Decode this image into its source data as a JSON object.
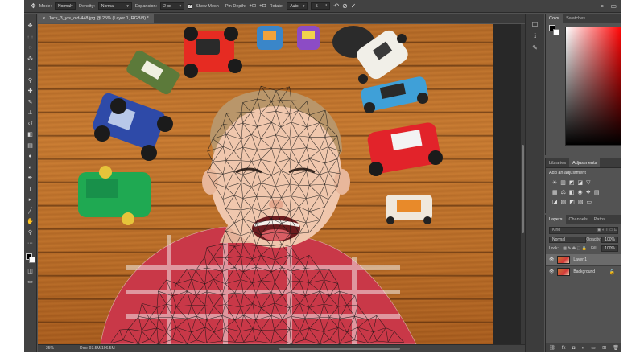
{
  "options_bar": {
    "mode_label": "Mode:",
    "mode_value": "Normal",
    "density_label": "Density:",
    "density_value": "Normal",
    "expansion_label": "Expansion:",
    "expansion_value": "2 px",
    "show_mesh_label": "Show Mesh",
    "show_mesh_checked": true,
    "pin_depth_label": "Pin Depth:",
    "rotate_label": "Rotate:",
    "rotate_value": "Auto",
    "rotate_degrees": "-5"
  },
  "document": {
    "tab_title": "Jack_3_yrs_old-448.jpg @ 25% (Layer 1, RGB/8) *",
    "zoom": "25%",
    "doc_info": "Doc: 93.5M/196.5M"
  },
  "color_panel": {
    "tabs": [
      "Color",
      "Swatches"
    ]
  },
  "adjustments_panel": {
    "tabs": [
      "Libraries",
      "Adjustments"
    ],
    "title": "Add an adjustment"
  },
  "layers_panel": {
    "tabs": [
      "Layers",
      "Channels",
      "Paths"
    ],
    "kind_placeholder": "Kind",
    "blend_mode": "Normal",
    "opacity_label": "Opacity:",
    "opacity_value": "100%",
    "lock_label": "Lock:",
    "fill_label": "Fill:",
    "fill_value": "100%",
    "layers": [
      {
        "name": "Layer 1",
        "selected": true
      },
      {
        "name": "Background",
        "selected": false,
        "locked": true
      }
    ]
  },
  "icons": {
    "tool": "puppet-warp-icon",
    "search": "search-icon",
    "workspace": "workspace-icon",
    "commit": "check-icon",
    "cancel": "cancel-icon"
  },
  "colors": {
    "app_bg": "#535353",
    "bar_bg": "#424242",
    "mesh": "#1a1a1a"
  }
}
